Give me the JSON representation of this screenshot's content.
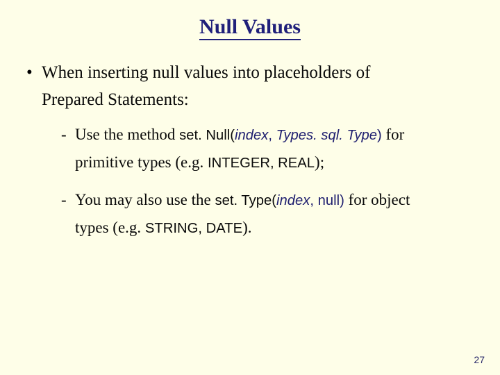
{
  "title": "Null Values",
  "bullet1_a": "When inserting null values into placeholders of",
  "bullet1_b": "Prepared Statements:",
  "sub1_pre": "Use the method ",
  "sub1_method": "set. Null(",
  "sub1_arg1": "index",
  "sub1_sep": ", ",
  "sub1_arg2": "Types. sql. Type",
  "sub1_close": ")",
  "sub1_post_a": " for",
  "sub1_line2a": "primitive types (e.g. ",
  "sub1_types": "INTEGER, REAL",
  "sub1_line2b": ");",
  "sub2_pre": "You may also use the ",
  "sub2_method": "set. Type(",
  "sub2_arg1": "index",
  "sub2_sep": ", ",
  "sub2_arg2": "null",
  "sub2_close": ")",
  "sub2_post_a": " for object",
  "sub2_line2a": "types (e.g. ",
  "sub2_types": "STRING, DATE",
  "sub2_line2b": ").",
  "page_number": "27"
}
